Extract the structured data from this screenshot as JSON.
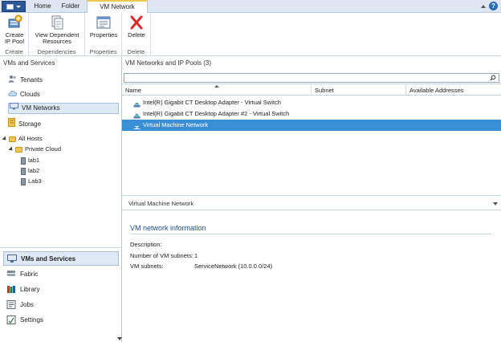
{
  "tabs": {
    "home": "Home",
    "folder": "Folder",
    "vm_network": "VM Network"
  },
  "ribbon": {
    "create_button": "Create\nIP Pool",
    "create_group": "Create",
    "dependent_button": "View Dependent\nResources",
    "dependencies_group": "Dependencies",
    "properties_button": "Properties",
    "properties_group": "Properties",
    "delete_button": "Delete",
    "delete_group": "Delete"
  },
  "left": {
    "header": "VMs and Services",
    "nav": [
      "Tenants",
      "Clouds",
      "VM Networks",
      "Storage"
    ],
    "tree": {
      "all_hosts": "All Hosts",
      "private_cloud": "Private Cloud",
      "hosts": [
        "lab1",
        "lab2",
        "Lab3"
      ]
    },
    "wunderbar": [
      "VMs and Services",
      "Fabric",
      "Library",
      "Jobs",
      "Settings"
    ]
  },
  "main": {
    "list_title": "VM Networks and IP Pools (3)",
    "search_value": "",
    "columns": [
      "Name",
      "Subnet",
      "Available Addresses"
    ],
    "rows": [
      "Intel(R) Gigabit CT Desktop Adapter - Virtual Switch",
      "Intel(R) Gigabit CT Desktop Adapter #2 - Virtual Switch",
      "Virtual Machine Network"
    ],
    "detail_header": "Virtual Machine Network",
    "info_title": "VM network information",
    "description_label": "Description:",
    "description_value": "",
    "subnet_count_label": "Number of VM subnets:",
    "subnet_count_value": "1",
    "subnets_label": "VM subnets:",
    "subnets_value": "ServiceNetwork (10.0.0.0/24)"
  },
  "colors": {
    "accent": "#2b5797",
    "selection": "#3b8fd9",
    "tab_highlight": "#f3c64d",
    "pane_border": "#b6c7dc"
  }
}
